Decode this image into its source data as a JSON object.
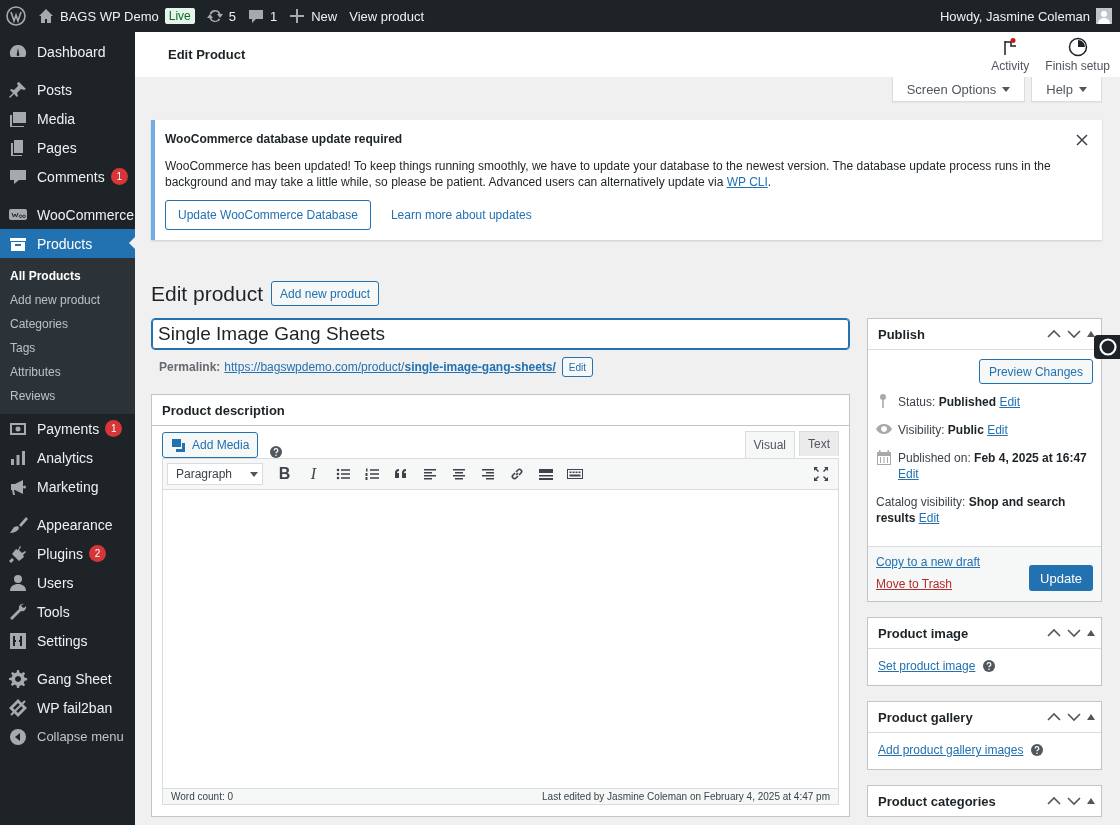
{
  "admin_bar": {
    "site_name": "BAGS WP Demo",
    "live_badge": "Live",
    "updates_count": "5",
    "comments_count": "1",
    "new_label": "New",
    "view_label": "View product",
    "howdy": "Howdy, Jasmine Coleman"
  },
  "sidebar": {
    "groups": [
      [
        {
          "label": "Dashboard",
          "selected": false
        }
      ],
      [
        {
          "label": "Posts",
          "selected": false
        },
        {
          "label": "Media",
          "selected": false
        },
        {
          "label": "Pages",
          "selected": false
        },
        {
          "label": "Comments",
          "selected": false,
          "badge": "1"
        }
      ],
      [
        {
          "label": "WooCommerce",
          "selected": false
        },
        {
          "label": "Products",
          "selected": true,
          "children": [
            {
              "label": "All Products",
              "selected": true
            },
            {
              "label": "Add new product",
              "selected": false
            },
            {
              "label": "Categories",
              "selected": false
            },
            {
              "label": "Tags",
              "selected": false
            },
            {
              "label": "Attributes",
              "selected": false
            },
            {
              "label": "Reviews",
              "selected": false
            }
          ]
        },
        {
          "label": "Payments",
          "selected": false,
          "badge": "1"
        },
        {
          "label": "Analytics",
          "selected": false
        },
        {
          "label": "Marketing",
          "selected": false
        }
      ],
      [
        {
          "label": "Appearance",
          "selected": false
        },
        {
          "label": "Plugins",
          "selected": false,
          "badge": "2"
        },
        {
          "label": "Users",
          "selected": false
        },
        {
          "label": "Tools",
          "selected": false
        },
        {
          "label": "Settings",
          "selected": false
        }
      ],
      [
        {
          "label": "Gang Sheet",
          "selected": false
        },
        {
          "label": "WP fail2ban",
          "selected": false
        }
      ]
    ],
    "collapse_label": "Collapse menu"
  },
  "header": {
    "title": "Edit Product",
    "actions": [
      {
        "kind": "activity",
        "label": "Activity"
      },
      {
        "kind": "setup",
        "label": "Finish setup"
      }
    ]
  },
  "screen_tabs": [
    "Screen Options",
    "Help"
  ],
  "notice": {
    "title": "WooCommerce database update required",
    "text_before": "WooCommerce has been updated! To keep things running smoothly, we have to update your database to the newest version. The database update process runs in the background and may take a little while, so please be patient. Advanced users can alternatively update via ",
    "link": "WP CLI",
    "text_after": ".",
    "button": "Update WooCommerce Database",
    "learn_more": "Learn more about updates"
  },
  "page_title": "Edit product",
  "add_new": "Add new product",
  "title_field": {
    "value": "Single Image Gang Sheets"
  },
  "permalink": {
    "label": "Permalink:",
    "url": "https://bagswpdemo.com/product/**single-image-gang-sheets/**",
    "edit": "Edit"
  },
  "editor": {
    "heading": "Product description",
    "add_media": "Add Media",
    "tabs": [
      {
        "label": "Visual",
        "selected": true
      },
      {
        "label": "Text",
        "selected": false
      }
    ],
    "format": "Paragraph",
    "toolbar": [
      {
        "kind": "bold",
        "text": "B"
      },
      {
        "kind": "italic",
        "text": "I"
      },
      {
        "kind": "bullets"
      },
      {
        "kind": "numbers"
      },
      {
        "kind": "quote"
      },
      {
        "kind": "align-left"
      },
      {
        "kind": "align-center"
      },
      {
        "kind": "align-right"
      },
      {
        "kind": "link"
      },
      {
        "kind": "more"
      },
      {
        "kind": "keyboard"
      },
      {
        "kind": "fullscreen"
      }
    ],
    "word_count": "Word count: 0",
    "last_edited": "Last edited by Jasmine Coleman on February 4, 2025 at 4:47 pm"
  },
  "publish": {
    "title": "Publish",
    "preview": "Preview Changes",
    "rows": [
      {
        "kind": "status",
        "text": "Status: **Published**",
        "link": "Edit"
      },
      {
        "kind": "visibility",
        "text": "Visibility: **Public**",
        "link": "Edit"
      },
      {
        "kind": "date",
        "text": "Published on: **Feb 4, 2025 at 16:47**",
        "link": "Edit"
      },
      {
        "kind": "catalog",
        "text": "Catalog visibility: **Shop and search results**",
        "link": "Edit"
      }
    ],
    "copy_link": "Copy to a new draft",
    "trash_link": "Move to Trash",
    "update": "Update"
  },
  "side_boxes": [
    {
      "title": "Product image",
      "link": "Set product image"
    },
    {
      "title": "Product gallery",
      "link": "Add product gallery images"
    },
    {
      "title": "Product categories"
    }
  ]
}
